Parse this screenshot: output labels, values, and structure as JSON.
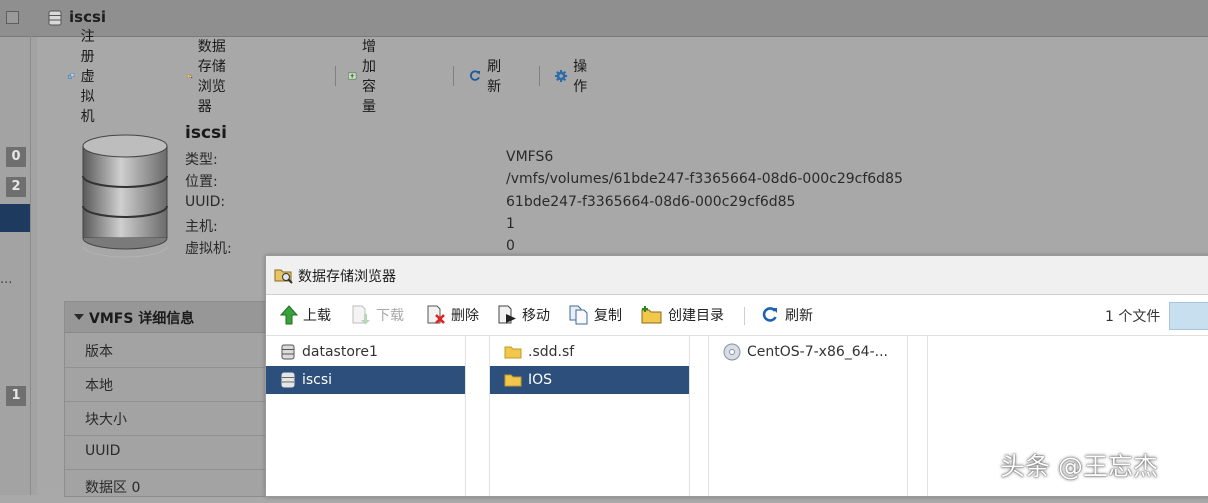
{
  "left_strip": {
    "badges": [
      "0",
      "2",
      "1"
    ],
    "dots": "..."
  },
  "header": {
    "title": "iscsi"
  },
  "toolbar": {
    "register_vm": "注册虚拟机",
    "datastore_browser": "数据存储浏览器",
    "increase_capacity": "增加容量",
    "refresh": "刷新",
    "actions": "操作"
  },
  "datastore": {
    "name": "iscsi",
    "props": [
      {
        "label": "类型:",
        "value": "VMFS6"
      },
      {
        "label": "位置:",
        "value": "/vmfs/volumes/61bde247-f3365664-08d6-000c29cf6d85"
      },
      {
        "label": "UUID:",
        "value": "61bde247-f3365664-08d6-000c29cf6d85"
      },
      {
        "label": "主机:",
        "value": "1"
      },
      {
        "label": "虚拟机:",
        "value": "0"
      }
    ]
  },
  "vmfs_panel": {
    "title": "VMFS 详细信息",
    "rows": [
      "版本",
      "本地",
      "块大小",
      "UUID",
      "数据区 0"
    ]
  },
  "dialog": {
    "title": "数据存储浏览器",
    "toolbar": {
      "upload": "上载",
      "download": "下载",
      "delete": "删除",
      "move": "移动",
      "copy": "复制",
      "create_dir": "创建目录",
      "refresh": "刷新"
    },
    "file_count": "1 个文件",
    "columns": [
      {
        "items": [
          "datastore1",
          "iscsi"
        ],
        "selected": 1
      },
      {
        "items": [
          ".sdd.sf",
          "IOS"
        ],
        "selected": 1
      },
      {
        "items": [
          "CentOS-7-x86_64-..."
        ],
        "selected": -1
      }
    ]
  },
  "watermark": "头条 @王忘杰"
}
